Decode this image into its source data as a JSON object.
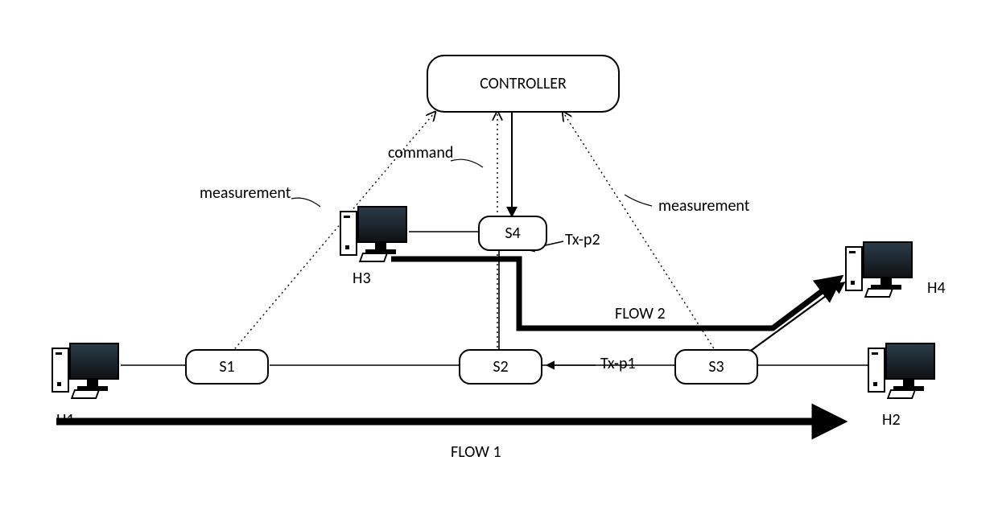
{
  "controller": {
    "label": "CONTROLLER"
  },
  "switches": {
    "s1": "S1",
    "s2": "S2",
    "s3": "S3",
    "s4": "S4"
  },
  "hosts": {
    "h1": "H1",
    "h2": "H2",
    "h3": "H3",
    "h4": "H4"
  },
  "links": {
    "command": "command",
    "measurement_left": "measurement",
    "measurement_right": "measurement",
    "tx_p1": "Tx-p1",
    "tx_p2": "Tx-p2"
  },
  "flows": {
    "flow1": "FLOW 1",
    "flow2": "FLOW 2"
  }
}
